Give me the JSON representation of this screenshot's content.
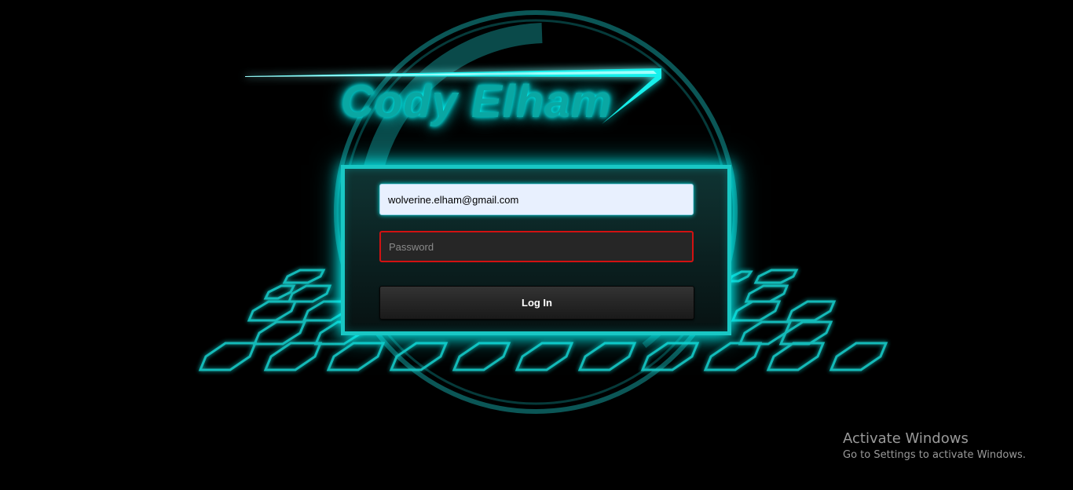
{
  "logo": {
    "text": "Cody Elham"
  },
  "login": {
    "email_value": "wolverine.elham@gmail.com",
    "password_placeholder": "Password",
    "login_label": "Log In"
  },
  "watermark": {
    "title": "Activate Windows",
    "subtitle": "Go to Settings to activate Windows."
  },
  "colors": {
    "background": "#000000",
    "neon_cyan": "#19c7c4",
    "logo_teal": "#0aa7a3",
    "error_red": "#d21212",
    "autofill_blue": "#e8f0fe"
  }
}
